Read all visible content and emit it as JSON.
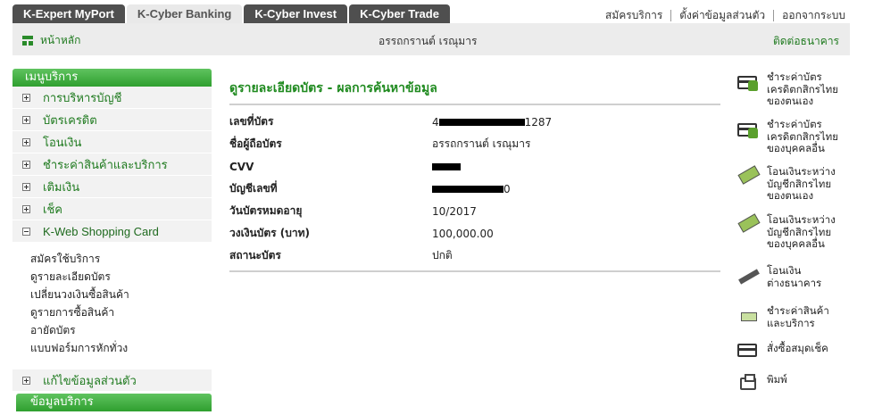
{
  "top_tabs": [
    "K-Expert MyPort",
    "K-Cyber Banking",
    "K-Cyber Invest",
    "K-Cyber Trade"
  ],
  "top_links": [
    "สมัครบริการ",
    "ตั้งค่าข้อมูลส่วนตัว",
    "ออกจากระบบ"
  ],
  "header": {
    "home_label": "หน้าหลัก",
    "user_name": "อรรถกรานต์ เรณุมาร",
    "contact_label": "ติดต่อธนาคาร"
  },
  "sidebar": {
    "title": "เมนูบริการ",
    "items": [
      {
        "label": "การบริหารบัญชี"
      },
      {
        "label": "บัตรเครดิต"
      },
      {
        "label": "โอนเงิน"
      },
      {
        "label": "ชำระค่าสินค้าและบริการ"
      },
      {
        "label": "เติมเงิน"
      },
      {
        "label": "เช็ค"
      },
      {
        "label": "K-Web Shopping Card"
      }
    ],
    "submenu": [
      "สมัครใช้บริการ",
      "ดูรายละเอียดบัตร",
      "เปลี่ยนวงเงินซื้อสินค้า",
      "ดูรายการซื้อสินค้า",
      "อายัดบัตร",
      "แบบฟอร์มการหักทั่วง"
    ],
    "personal_label": "แก้ไขข้อมูลส่วนตัว",
    "info_title": "ข้อมูลบริการ"
  },
  "main": {
    "title": "ดูรายละเอียดบัตร - ผลการค้นหาข้อมูล",
    "rows": [
      {
        "label": "เลขที่บัตร",
        "prefix": "4",
        "suffix": "1287"
      },
      {
        "label": "ชื่อผู้ถือบัตร",
        "value": "อรรถกรานต์ เรณุมาร"
      },
      {
        "label": "CVV",
        "value": ""
      },
      {
        "label": "บัญชีเลขที่",
        "suffix": "0"
      },
      {
        "label": "วันบัตรหมดอายุ",
        "value": "10/2017"
      },
      {
        "label": "วงเงินบัตร (บาท)",
        "value": "100,000.00"
      },
      {
        "label": "สถานะบัตร",
        "value": "ปกติ"
      }
    ]
  },
  "actions": [
    {
      "line1": "ชำระค่าบัตร",
      "line2": "เครดิตกสิกรไทย",
      "line3": "ของตนเอง",
      "icon": "credit-card-payment-icon"
    },
    {
      "line1": "ชำระค่าบัตร",
      "line2": "เครดิตกสิกรไทย",
      "line3": "ของบุคคลอื่น",
      "icon": "credit-card-payment-icon"
    },
    {
      "line1": "โอนเงินระหว่าง",
      "line2": "บัญชีกสิกรไทย",
      "line3": "ของตนเอง",
      "icon": "transfer-icon"
    },
    {
      "line1": "โอนเงินระหว่าง",
      "line2": "บัญชีกสิกรไทย",
      "line3": "ของบุคคลอื่น",
      "icon": "transfer-icon"
    },
    {
      "line1": "โอนเงิน",
      "line2": "ต่างธนาคาร",
      "icon": "interbank-transfer-icon"
    },
    {
      "line1": "ชำระค่าสินค้า",
      "line2": "และบริการ",
      "icon": "bill-payment-icon"
    },
    {
      "line1": "สั่งซื้อสมุดเช็ค",
      "icon": "cheque-book-icon"
    },
    {
      "line1": "พิมพ์",
      "icon": "printer-icon"
    }
  ],
  "colors": {
    "brand_green": "#2f9f2f",
    "link_green": "#1f7a1f",
    "tab_dark": "#4f4f4f",
    "header_gray": "#ececec"
  }
}
